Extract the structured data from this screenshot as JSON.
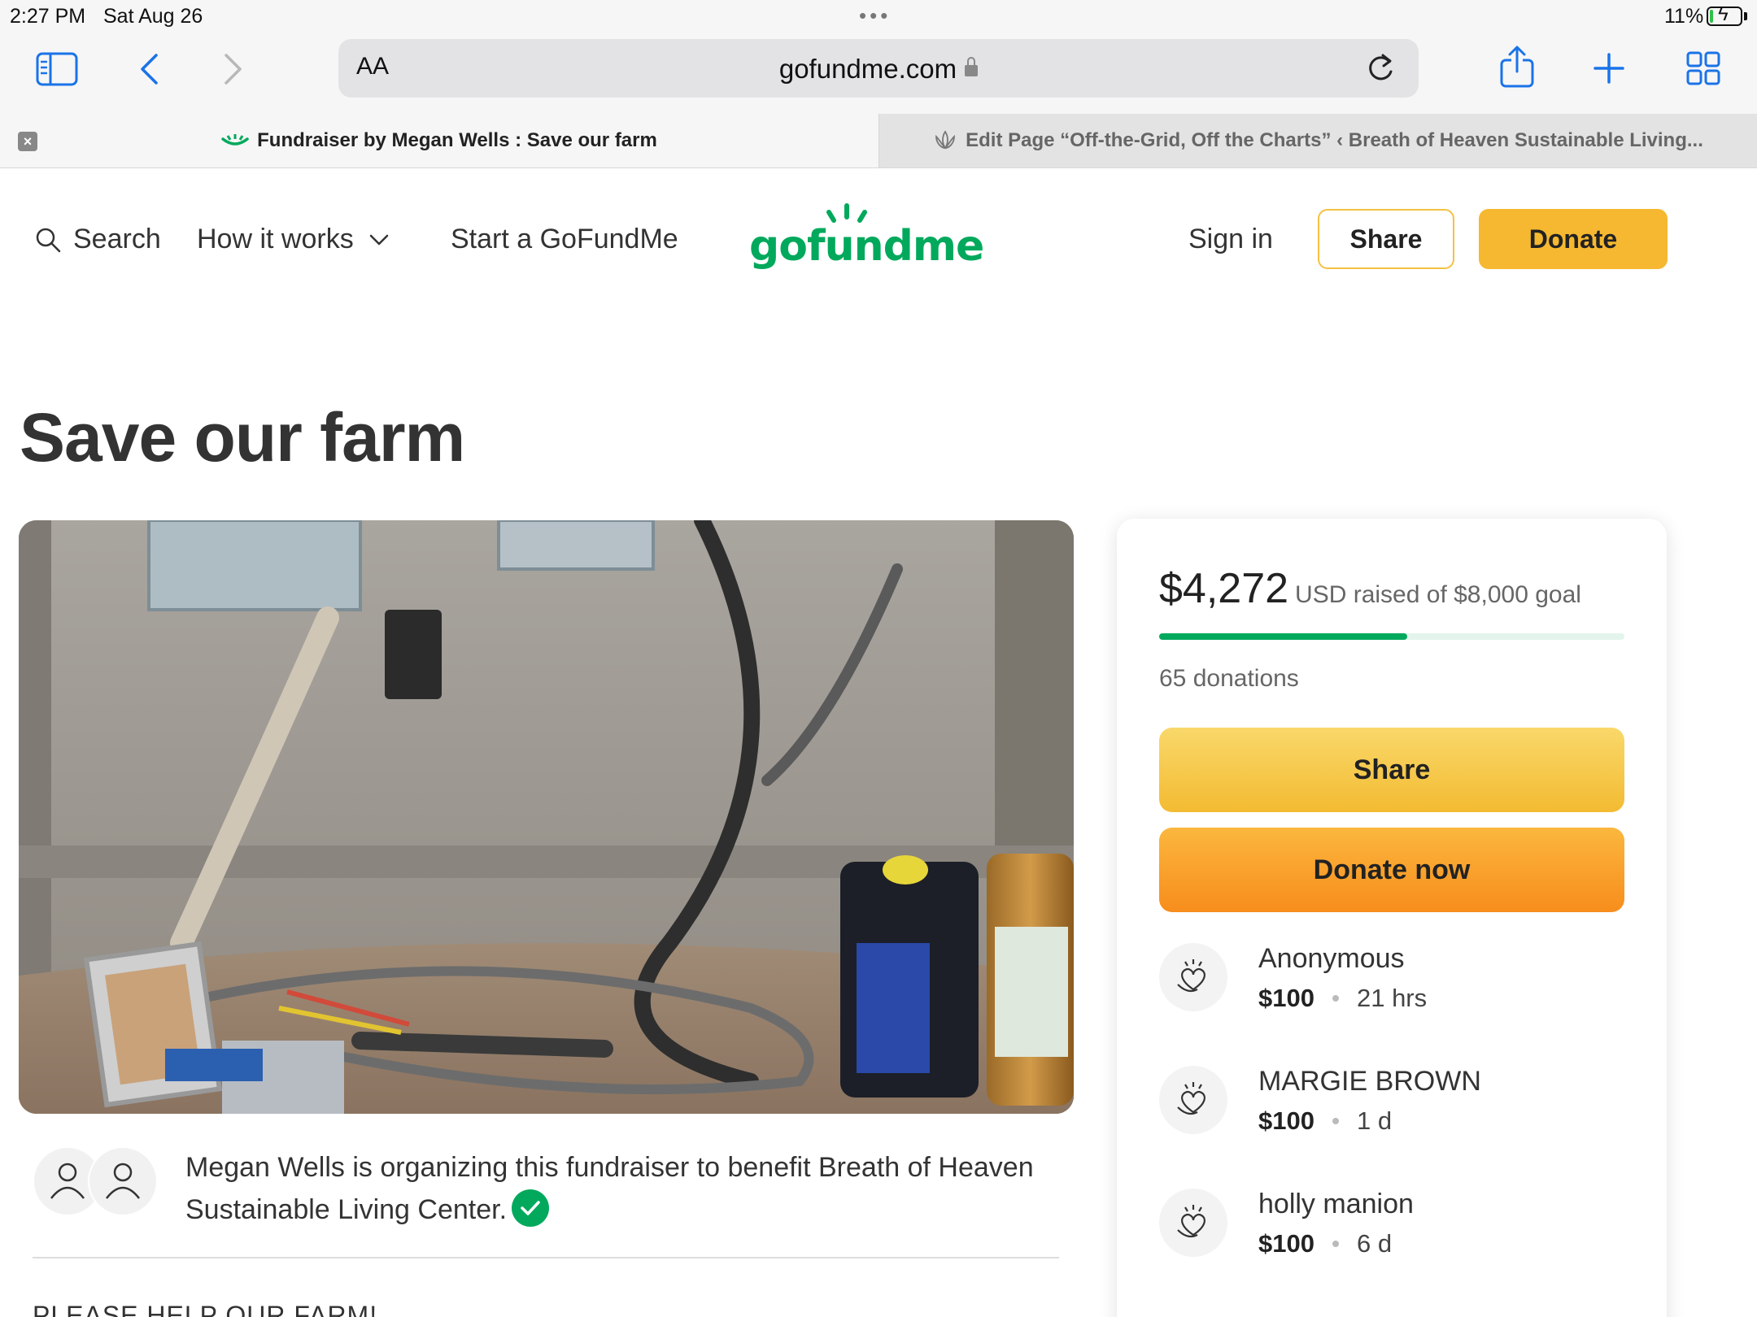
{
  "status_bar": {
    "time": "2:27 PM",
    "date": "Sat Aug 26",
    "battery_percent": "11%",
    "battery_level": 0.11
  },
  "browser": {
    "text_size_label": "AA",
    "url": "gofundme.com",
    "tabs": [
      {
        "title": "Fundraiser by Megan Wells : Save our farm",
        "active": true
      },
      {
        "title": "Edit Page “Off-the-Grid, Off the Charts” ‹ Breath of Heaven Sustainable Living...",
        "active": false
      }
    ]
  },
  "site_header": {
    "search_label": "Search",
    "how_it_works_label": "How it works",
    "start_label": "Start a GoFundMe",
    "logo_text": "gofundme",
    "sign_in_label": "Sign in",
    "share_label": "Share",
    "donate_label": "Donate"
  },
  "fundraiser": {
    "title": "Save our farm",
    "organizer_text": "Megan Wells is organizing this fundraiser to benefit Breath of Heaven Sustainable Living Center.",
    "story_start": "PLEASE HELP OUR FARM!"
  },
  "card": {
    "amount_raised": "$4,272",
    "raised_text": "USD raised of $8,000 goal",
    "progress_fraction": 0.534,
    "donations_count": "65 donations",
    "share_label": "Share",
    "donate_now_label": "Donate now",
    "donors": [
      {
        "name": "Anonymous",
        "amount": "$100",
        "time": "21 hrs"
      },
      {
        "name": "MARGIE BROWN",
        "amount": "$100",
        "time": "1 d"
      },
      {
        "name": "holly manion",
        "amount": "$100",
        "time": "6 d"
      }
    ]
  },
  "colors": {
    "brand_green": "#02a95c",
    "donate_orange": "#f6b830",
    "link_blue": "#1a73e8"
  }
}
